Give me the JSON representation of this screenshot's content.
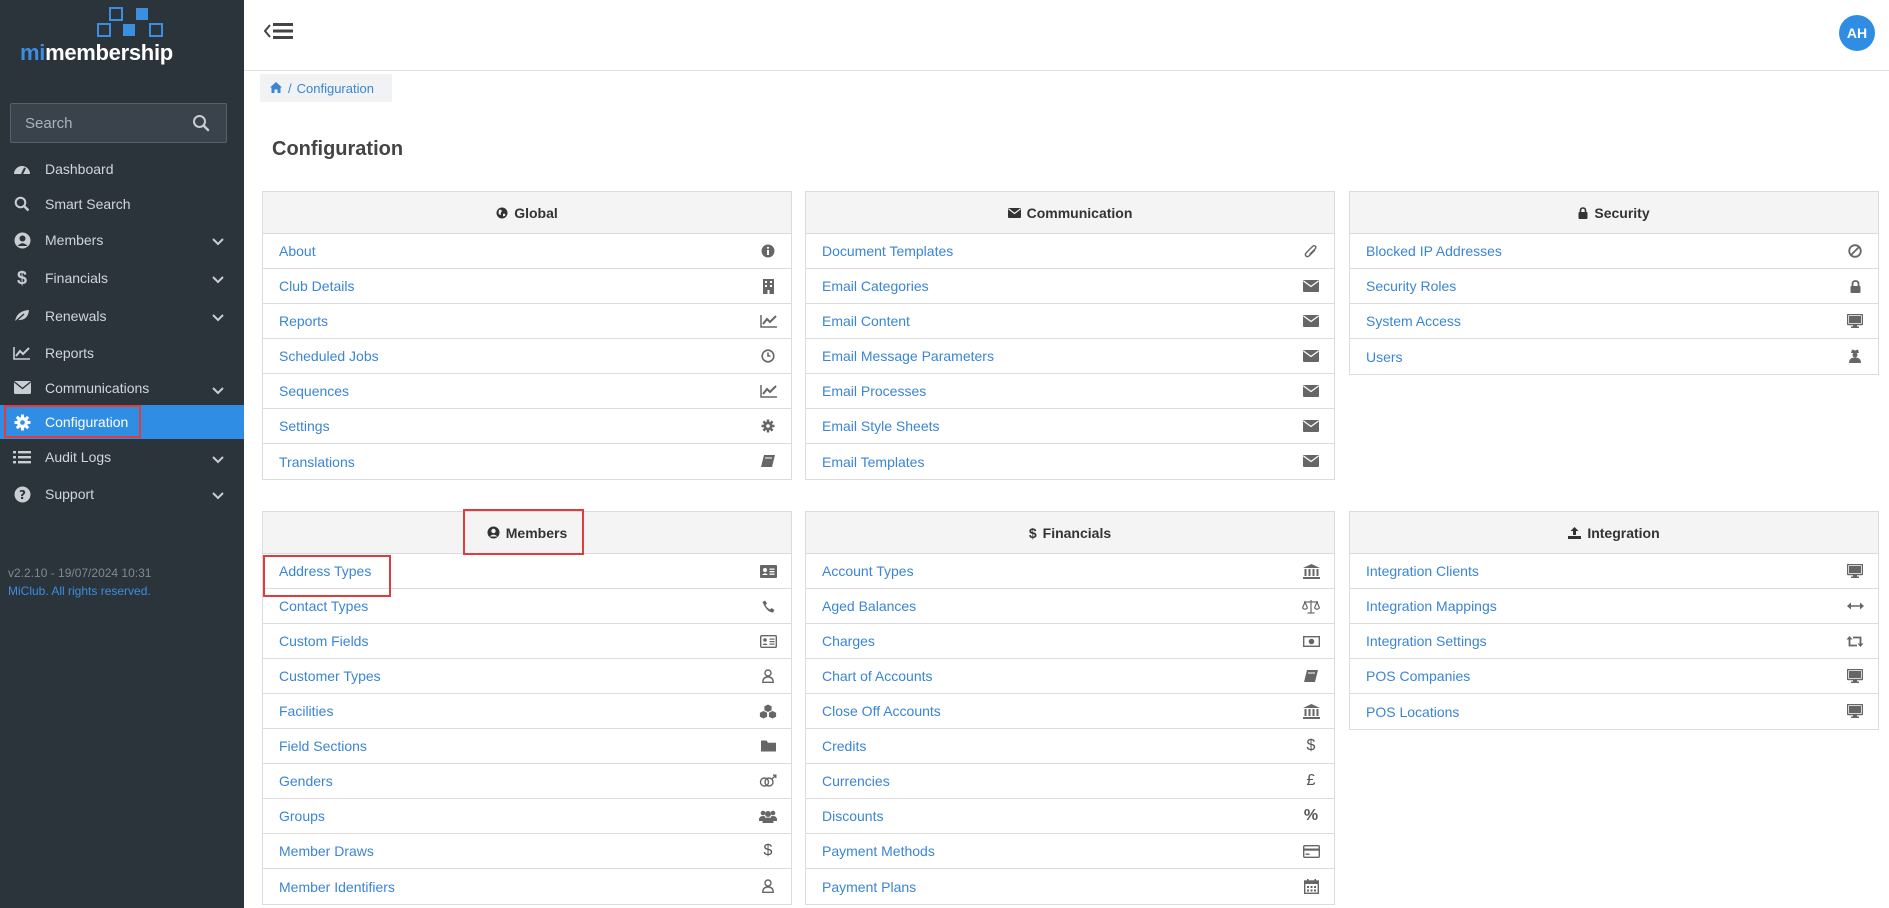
{
  "app": {
    "logo_prefix": "mi",
    "logo_suffix": "membership",
    "version": "v2.2.10 - 19/07/2024 10:31",
    "rights": "MiClub. All rights reserved.",
    "user_initials": "AH",
    "accent_color": "#2f8de4"
  },
  "search": {
    "placeholder": "Search",
    "value": ""
  },
  "nav": [
    {
      "label": "Dashboard",
      "icon": "dashboard-icon",
      "expandable": false,
      "active": false
    },
    {
      "label": "Smart Search",
      "icon": "search-icon",
      "expandable": false,
      "active": false
    },
    {
      "label": "Members",
      "icon": "user-circle-icon",
      "expandable": true,
      "active": false
    },
    {
      "label": "Financials",
      "icon": "dollar-icon",
      "expandable": true,
      "active": false
    },
    {
      "label": "Renewals",
      "icon": "leaf-icon",
      "expandable": true,
      "active": false
    },
    {
      "label": "Reports",
      "icon": "line-chart-icon",
      "expandable": false,
      "active": false
    },
    {
      "label": "Communications",
      "icon": "envelope-icon",
      "expandable": true,
      "active": false
    },
    {
      "label": "Configuration",
      "icon": "gear-icon",
      "expandable": false,
      "active": true
    },
    {
      "label": "Audit Logs",
      "icon": "list-icon",
      "expandable": true,
      "active": false
    },
    {
      "label": "Support",
      "icon": "question-icon",
      "expandable": true,
      "active": false
    }
  ],
  "breadcrumb": {
    "current": "Configuration"
  },
  "page_title": "Configuration",
  "panels": {
    "global": {
      "title": "Global",
      "icon": "globe-icon",
      "items": [
        {
          "label": "About",
          "icon": "info-icon"
        },
        {
          "label": "Club Details",
          "icon": "building-icon"
        },
        {
          "label": "Reports",
          "icon": "line-chart-icon"
        },
        {
          "label": "Scheduled Jobs",
          "icon": "clock-icon"
        },
        {
          "label": "Sequences",
          "icon": "line-chart-icon"
        },
        {
          "label": "Settings",
          "icon": "gear-icon"
        },
        {
          "label": "Translations",
          "icon": "book-icon"
        }
      ]
    },
    "communication": {
      "title": "Communication",
      "icon": "envelope-icon",
      "items": [
        {
          "label": "Document Templates",
          "icon": "paperclip-icon"
        },
        {
          "label": "Email Categories",
          "icon": "envelope-icon"
        },
        {
          "label": "Email Content",
          "icon": "envelope-icon"
        },
        {
          "label": "Email Message Parameters",
          "icon": "envelope-icon"
        },
        {
          "label": "Email Processes",
          "icon": "envelope-icon"
        },
        {
          "label": "Email Style Sheets",
          "icon": "envelope-icon"
        },
        {
          "label": "Email Templates",
          "icon": "envelope-icon"
        }
      ]
    },
    "security": {
      "title": "Security",
      "icon": "lock-icon",
      "items": [
        {
          "label": "Blocked IP Addresses",
          "icon": "ban-icon"
        },
        {
          "label": "Security Roles",
          "icon": "lock-icon"
        },
        {
          "label": "System Access",
          "icon": "desktop-icon"
        },
        {
          "label": "Users",
          "icon": "user-secret-icon"
        }
      ]
    },
    "members": {
      "title": "Members",
      "icon": "user-circle-icon",
      "items": [
        {
          "label": "Address Types",
          "icon": "address-card-icon"
        },
        {
          "label": "Contact Types",
          "icon": "phone-icon"
        },
        {
          "label": "Custom Fields",
          "icon": "id-card-icon"
        },
        {
          "label": "Customer Types",
          "icon": "user-outline-icon"
        },
        {
          "label": "Facilities",
          "icon": "cubes-icon"
        },
        {
          "label": "Field Sections",
          "icon": "folder-icon"
        },
        {
          "label": "Genders",
          "icon": "genderless-icon"
        },
        {
          "label": "Groups",
          "icon": "users-icon"
        },
        {
          "label": "Member Draws",
          "icon": "dollar-icon"
        },
        {
          "label": "Member Identifiers",
          "icon": "user-outline-icon"
        }
      ]
    },
    "financials": {
      "title": "Financials",
      "icon": "dollar-icon",
      "items": [
        {
          "label": "Account Types",
          "icon": "bank-icon"
        },
        {
          "label": "Aged Balances",
          "icon": "balance-scale-icon"
        },
        {
          "label": "Charges",
          "icon": "money-icon"
        },
        {
          "label": "Chart of Accounts",
          "icon": "book-icon"
        },
        {
          "label": "Close Off Accounts",
          "icon": "bank-icon"
        },
        {
          "label": "Credits",
          "icon": "dollar-icon"
        },
        {
          "label": "Currencies",
          "icon": "pound-icon"
        },
        {
          "label": "Discounts",
          "icon": "percent-icon"
        },
        {
          "label": "Payment Methods",
          "icon": "credit-card-icon"
        },
        {
          "label": "Payment Plans",
          "icon": "calendar-icon"
        }
      ]
    },
    "integration": {
      "title": "Integration",
      "icon": "upload-icon",
      "items": [
        {
          "label": "Integration Clients",
          "icon": "desktop-icon"
        },
        {
          "label": "Integration Mappings",
          "icon": "arrows-h-icon"
        },
        {
          "label": "Integration Settings",
          "icon": "retweet-icon"
        },
        {
          "label": "POS Companies",
          "icon": "desktop-icon"
        },
        {
          "label": "POS Locations",
          "icon": "desktop-icon"
        }
      ]
    }
  }
}
